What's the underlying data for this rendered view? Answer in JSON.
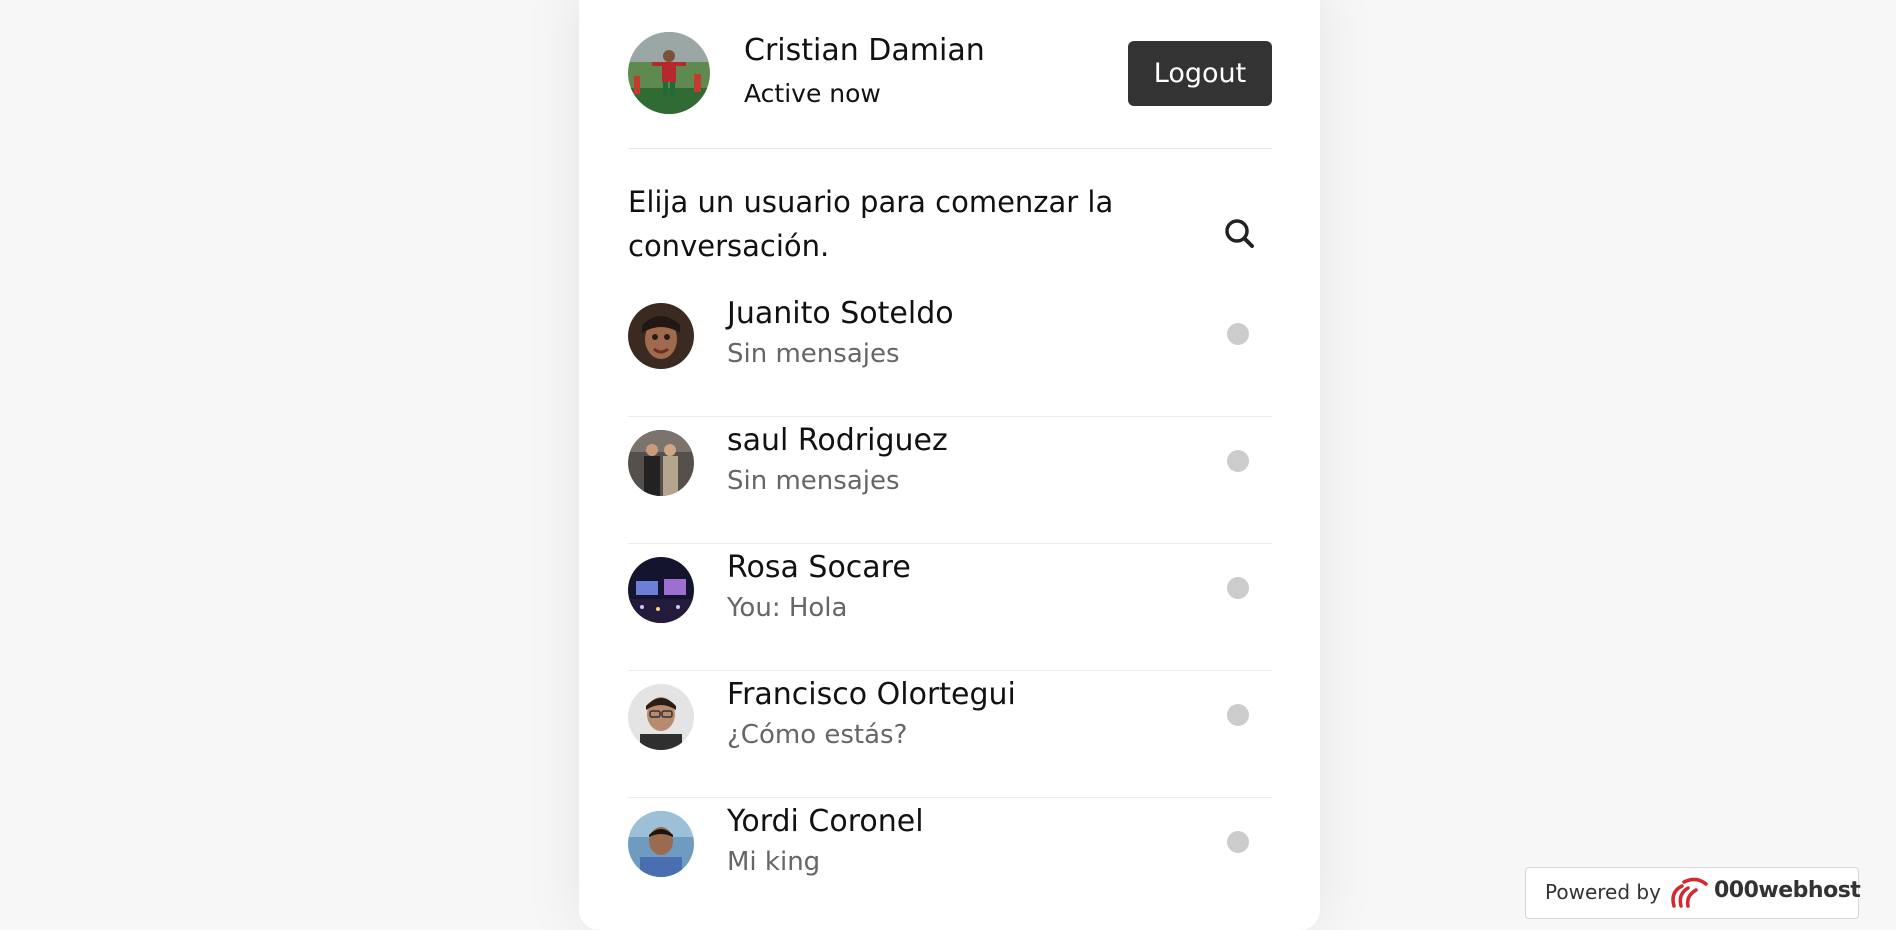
{
  "current_user": {
    "name": "Cristian Damian",
    "status": "Active now",
    "avatar_icon": "football-player-avatar"
  },
  "header": {
    "logout_label": "Logout"
  },
  "search": {
    "prompt": "Elija un usuario para comenzar la conversación.",
    "icon": "search-icon"
  },
  "users": [
    {
      "name": "Juanito Soteldo",
      "last_message": "Sin mensajes",
      "status": "offline"
    },
    {
      "name": "saul Rodriguez",
      "last_message": "Sin mensajes",
      "status": "offline"
    },
    {
      "name": "Rosa Socare",
      "last_message": "You: Hola",
      "status": "offline"
    },
    {
      "name": "Francisco Olortegui",
      "last_message": "¿Cómo estás?",
      "status": "offline"
    },
    {
      "name": "Yordi Coronel",
      "last_message": "Mi king",
      "status": "offline"
    }
  ],
  "footer": {
    "powered_label": "Powered by",
    "brand": "000webhost"
  },
  "colors": {
    "background": "#f7f7f7",
    "logout_button": "#333333",
    "status_offline": "#cccccc",
    "muted_text": "#666666"
  }
}
